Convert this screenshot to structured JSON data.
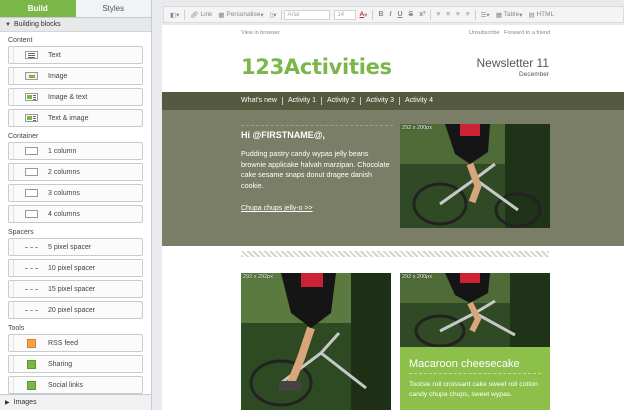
{
  "sidebar": {
    "tabs": {
      "build": "Build",
      "styles": "Styles"
    },
    "section_title": "Building blocks",
    "groups": {
      "content": "Content",
      "container": "Container",
      "spacers": "Spacers",
      "tools": "Tools"
    },
    "content_items": [
      "Text",
      "Image",
      "Image & text",
      "Text & image"
    ],
    "container_items": [
      "1 column",
      "2 columns",
      "3 columns",
      "4 columns"
    ],
    "spacer_items": [
      "5 pixel spacer",
      "10 pixel spacer",
      "15 pixel spacer",
      "20 pixel spacer"
    ],
    "tool_items": [
      "RSS feed",
      "Sharing",
      "Social links"
    ],
    "footer": "Images"
  },
  "toolbar": {
    "link": "Link",
    "personalise": "Personalise",
    "font": "Arial",
    "size": "14",
    "bold": "B",
    "italic": "I",
    "underline": "U",
    "strike": "S",
    "superscript": "x²",
    "table": "Table",
    "html": "HTML"
  },
  "email": {
    "view_in_browser": "View in browser",
    "unsubscribe": "Unsubscribe",
    "forward": "Forward to a friend",
    "logo": "123Activities",
    "newsletter_title": "Newsletter 11",
    "newsletter_month": "December",
    "nav": [
      "What's new",
      "Activity 1",
      "Activity 2",
      "Activity 3",
      "Activity 4"
    ],
    "greeting": "Hi @FIRSTNAME@,",
    "body": "Pudding pastry candy wypas jelly beans brownie applicake halvah marzipan. Chocolate cake sesame snaps donut dragee danish cookie.",
    "cta": "Chupa chups jelly-o >>",
    "photo_label_1": "292 x 200px",
    "photo_label_2": "292 x 292px",
    "photo_label_3": "292 x 200px",
    "card_title": "Macaroon cheesecake",
    "card_body": "Tootsie roll croissant cake sweet roll cotton candy chupa chups, sweet wypas."
  },
  "colors": {
    "accent": "#7ab648",
    "nav": "#56583f",
    "hero": "#7a7e67",
    "card": "#8cc04b"
  }
}
